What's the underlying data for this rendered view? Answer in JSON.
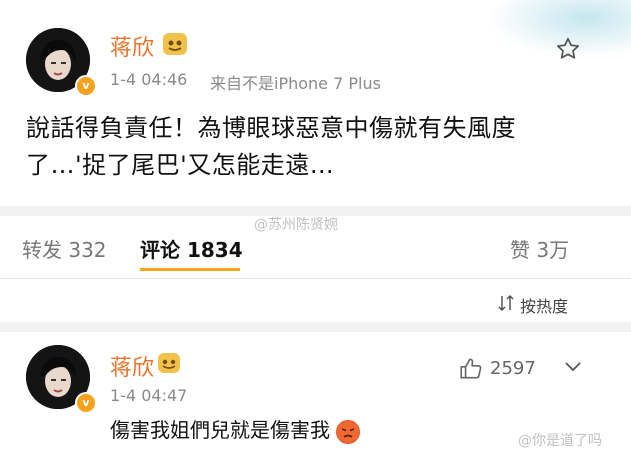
{
  "post": {
    "author": "蒋欣",
    "timestamp": "1-4 04:46",
    "source": "来自不是iPhone 7 Plus",
    "line1": "說話得負責任！為博眼球惡意中傷就有失風度",
    "line2": "了…'捉了尾巴'又怎能走遠…"
  },
  "watermark": {
    "center": "@苏州陈贤婉",
    "corner": "@你是道了吗"
  },
  "tabs": {
    "repost": "转发 332",
    "comments": "评论 1834",
    "likes": "赞 3万"
  },
  "sort": {
    "label": "按热度"
  },
  "comment": {
    "author": "蒋欣",
    "timestamp": "1-4 04:47",
    "like_count": "2597",
    "text": "傷害我姐們兒就是傷害我"
  },
  "colors": {
    "name": "#e8742b",
    "badge": "#f6a21c"
  }
}
